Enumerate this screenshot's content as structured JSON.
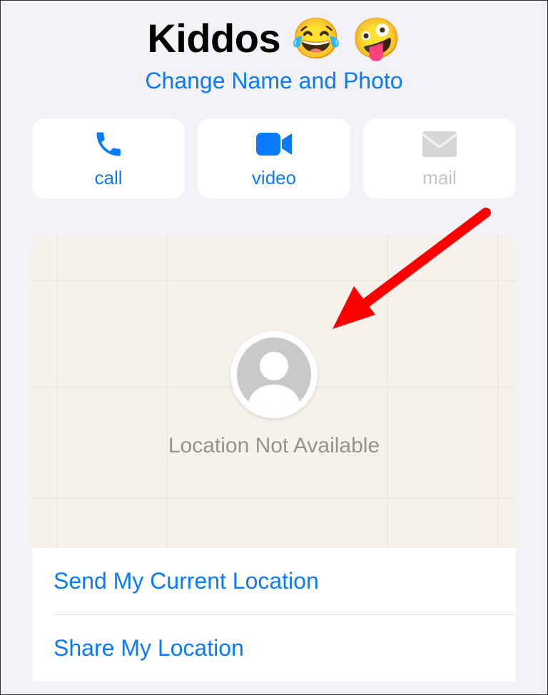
{
  "header": {
    "title": "Kiddos 😂 🤪",
    "subtitle": "Change Name and Photo"
  },
  "actions": {
    "call": "call",
    "video": "video",
    "mail": "mail"
  },
  "map": {
    "status": "Location Not Available"
  },
  "options": {
    "send": "Send My Current Location",
    "share": "Share My Location"
  }
}
